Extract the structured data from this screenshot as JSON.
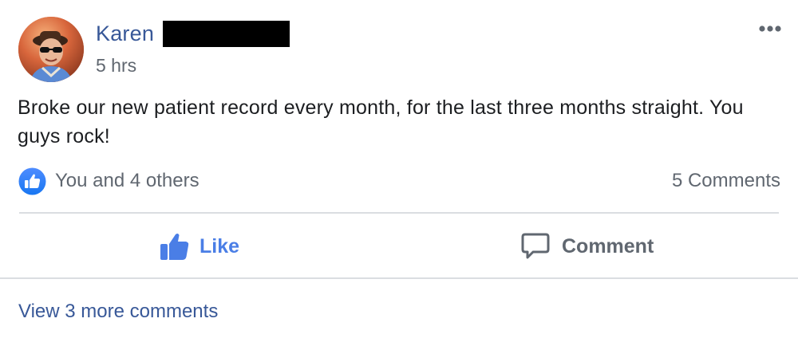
{
  "post": {
    "author_name": "Karen",
    "timestamp": "5 hrs",
    "text": "Broke our new patient record every month, for the last three months straight. You guys rock!",
    "more_icon": "more-horizontal-icon"
  },
  "reactions": {
    "summary": "You and 4 others",
    "comments_count": "5 Comments",
    "icon": "like-badge-icon"
  },
  "actions": {
    "like_label": "Like",
    "comment_label": "Comment"
  },
  "comments": {
    "view_more_label": "View 3 more comments"
  },
  "colors": {
    "link_blue": "#385898",
    "like_blue": "#4a7ee6",
    "secondary_text": "#606770",
    "divider": "#dadde1"
  }
}
